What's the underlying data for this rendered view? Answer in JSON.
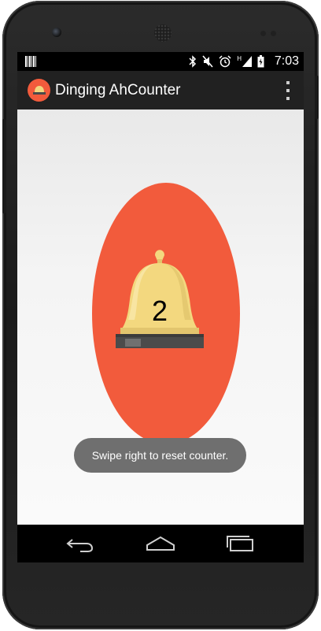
{
  "status_bar": {
    "time": "7:03",
    "network_type": "H",
    "icons": [
      "barcode-notification-icon",
      "bluetooth-icon",
      "mute-icon",
      "alarm-icon",
      "signal-icon",
      "battery-charging-icon"
    ]
  },
  "action_bar": {
    "title": "Dinging AhCounter",
    "app_icon": "bell-icon",
    "overflow_icon": "overflow-menu-icon"
  },
  "main": {
    "counter_value": "2",
    "bell_icon": "bell-icon",
    "colors": {
      "accent": "#f25b3c",
      "bell_body": "#f3d87f",
      "bell_base": "#4b4b4b"
    }
  },
  "toast": {
    "message": "Swipe right to reset counter."
  },
  "nav_bar": {
    "buttons": [
      "back-icon",
      "home-icon",
      "recents-icon"
    ]
  }
}
